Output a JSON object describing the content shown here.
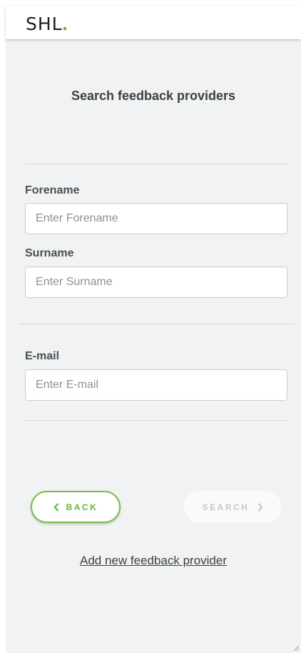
{
  "header": {
    "logo_text": "SHL",
    "logo_dot_color": "#62b73a"
  },
  "main": {
    "title": "Search feedback providers",
    "fields": {
      "forename": {
        "label": "Forename",
        "placeholder": "Enter Forename",
        "value": ""
      },
      "surname": {
        "label": "Surname",
        "placeholder": "Enter Surname",
        "value": ""
      },
      "email": {
        "label": "E-mail",
        "placeholder": "Enter E-mail",
        "value": ""
      }
    },
    "buttons": {
      "back_label": "BACK",
      "back_icon": "chevron-left-icon",
      "search_label": "SEARCH",
      "search_icon": "chevron-right-icon",
      "search_enabled": false
    },
    "add_provider_link": "Add new feedback provider"
  },
  "colors": {
    "accent": "#62b73a",
    "background": "#f1f2f3",
    "text": "#3c4144",
    "disabled_text": "#c5c8ca"
  }
}
